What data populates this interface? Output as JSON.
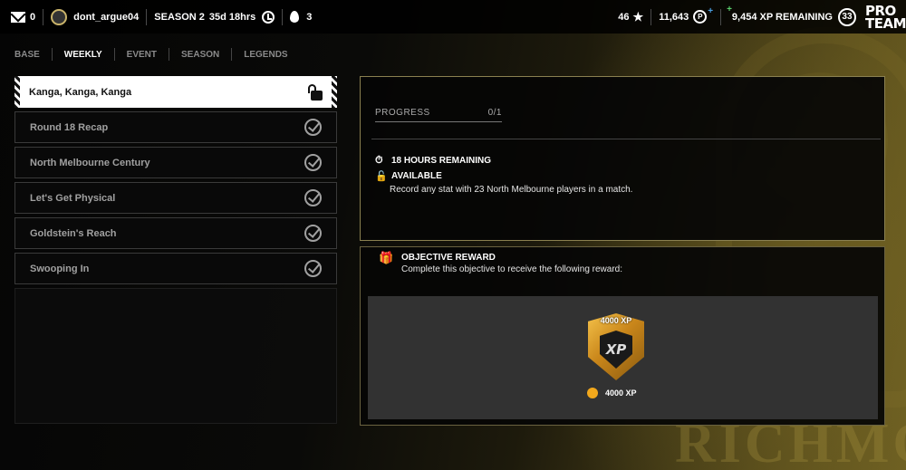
{
  "topbar": {
    "mail_count": "0",
    "username": "dont_argue04",
    "season": "SEASON 2",
    "time_remaining": "35d 18hrs",
    "streak": "3",
    "stars": "46",
    "coins": "11,643",
    "xp_remaining": "9,454 XP REMAINING",
    "level": "33",
    "logo_line1": "PRO",
    "logo_line2": "TEAM"
  },
  "tabs": [
    {
      "label": "BASE",
      "active": false
    },
    {
      "label": "WEEKLY",
      "active": true
    },
    {
      "label": "EVENT",
      "active": false
    },
    {
      "label": "SEASON",
      "active": false
    },
    {
      "label": "LEGENDS",
      "active": false
    }
  ],
  "objectives": [
    {
      "title": "Kanga, Kanga, Kanga",
      "status": "unlocked"
    },
    {
      "title": "Round 18 Recap",
      "status": "complete"
    },
    {
      "title": "North Melbourne Century",
      "status": "complete"
    },
    {
      "title": "Let's Get Physical",
      "status": "complete"
    },
    {
      "title": "Goldstein's Reach",
      "status": "complete"
    },
    {
      "title": "Swooping In",
      "status": "complete"
    }
  ],
  "detail": {
    "progress_label": "PROGRESS",
    "progress_value": "0/1",
    "hours_remaining": "18 HOURS REMAINING",
    "availability": "AVAILABLE",
    "description": "Record any stat with 23 North Melbourne players in a match."
  },
  "reward": {
    "title": "OBJECTIVE REWARD",
    "subtitle": "Complete this objective to receive the following reward:",
    "badge_label": "4000 XP",
    "badge_text": "XP",
    "item_label": "4000 XP"
  },
  "watermark": "RICHMO",
  "colors": {
    "accent_gold": "#c9b36a",
    "reward_gold": "#f2a81c",
    "panel_border": "#8a8050"
  }
}
